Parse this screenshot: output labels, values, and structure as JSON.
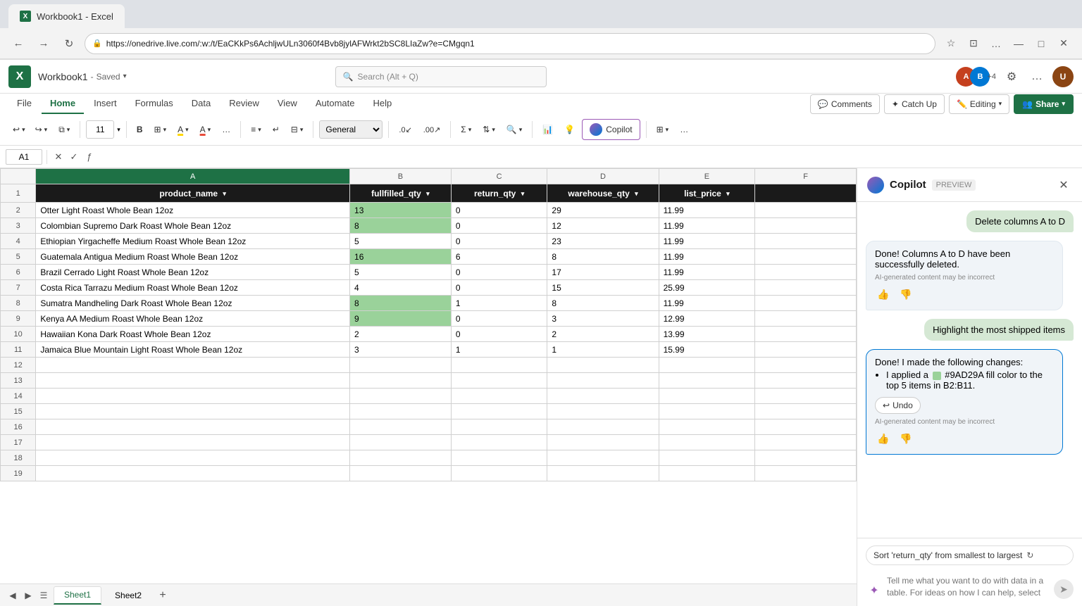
{
  "browser": {
    "tab_favicon": "X",
    "tab_title": "Workbook1 - Excel",
    "url": "https://onedrive.live.com/:w:/t/EaCKkPs6AchljwULn3060f4Bvb8jylAFWrkt2bSC8LIaZw?e=CMgqn1",
    "back_btn": "←",
    "forward_btn": "→",
    "refresh_btn": "↻",
    "star_icon": "☆",
    "collections_icon": "⊡",
    "more_icon": "…",
    "minimize_icon": "—",
    "maximize_icon": "□",
    "close_icon": "✕"
  },
  "app_header": {
    "logo": "X",
    "title": "Workbook1",
    "save_status": "Saved",
    "search_placeholder": "Search (Alt + Q)",
    "gear_icon": "⚙",
    "more_icon": "…",
    "avatar1_text": "A",
    "avatar2_text": "B",
    "plus_count": "+4",
    "user_avatar": "U"
  },
  "ribbon": {
    "tabs": [
      {
        "label": "File",
        "active": false
      },
      {
        "label": "Home",
        "active": true
      },
      {
        "label": "Insert",
        "active": false
      },
      {
        "label": "Formulas",
        "active": false
      },
      {
        "label": "Data",
        "active": false
      },
      {
        "label": "Review",
        "active": false
      },
      {
        "label": "View",
        "active": false
      },
      {
        "label": "Automate",
        "active": false
      },
      {
        "label": "Help",
        "active": false
      }
    ],
    "undo_icon": "↩",
    "redo_icon": "↪",
    "clipboard_icon": "⧉",
    "font_size": "11",
    "bold_icon": "B",
    "borders_icon": "⊞",
    "fill_icon": "A",
    "font_color_icon": "A",
    "more_icon": "…",
    "align_icon": "≡",
    "wrap_icon": "⬡",
    "merge_icon": "⊟",
    "format_label": "General",
    "decrease_decimal": ".0",
    "increase_decimal": ".00",
    "sum_icon": "Σ",
    "sort_icon": "⇅",
    "find_icon": "⌕",
    "analyze_icon": "📊",
    "ideas_icon": "💡",
    "copilot_label": "Copilot",
    "comments_label": "Comments",
    "catchup_label": "Catch Up",
    "editing_label": "Editing",
    "share_label": "Share",
    "grid_icon": "⊞"
  },
  "formula_bar": {
    "cell_ref": "A1",
    "cancel_icon": "✕",
    "confirm_icon": "✓",
    "function_icon": "ƒ",
    "formula_value": ""
  },
  "spreadsheet": {
    "columns": [
      "",
      "A",
      "B",
      "C",
      "D",
      "E",
      "F"
    ],
    "header_row": {
      "row_num": "1",
      "cells": [
        {
          "value": "product_name",
          "has_filter": true
        },
        {
          "value": "fullfilled_qty",
          "has_filter": true
        },
        {
          "value": "return_qty",
          "has_filter": true
        },
        {
          "value": "warehouse_qty",
          "has_filter": true
        },
        {
          "value": "list_price",
          "has_filter": true
        },
        {
          "value": "",
          "has_filter": false
        }
      ]
    },
    "rows": [
      {
        "row_num": "2",
        "cells": [
          "Otter Light Roast Whole Bean 12oz",
          "13",
          "0",
          "29",
          "11.99",
          ""
        ],
        "highlight_b": true
      },
      {
        "row_num": "3",
        "cells": [
          "Colombian Supremo Dark Roast Whole Bean 12oz",
          "8",
          "0",
          "12",
          "11.99",
          ""
        ],
        "highlight_b": true
      },
      {
        "row_num": "4",
        "cells": [
          "Ethiopian Yirgacheffe Medium Roast Whole Bean 12oz",
          "5",
          "0",
          "23",
          "11.99",
          ""
        ],
        "highlight_b": false
      },
      {
        "row_num": "5",
        "cells": [
          "Guatemala Antigua Medium Roast Whole Bean 12oz",
          "16",
          "6",
          "8",
          "11.99",
          ""
        ],
        "highlight_b": true
      },
      {
        "row_num": "6",
        "cells": [
          "Brazil Cerrado Light Roast Whole Bean 12oz",
          "5",
          "0",
          "17",
          "11.99",
          ""
        ],
        "highlight_b": false
      },
      {
        "row_num": "7",
        "cells": [
          "Costa Rica Tarrazu Medium Roast Whole Bean 12oz",
          "4",
          "0",
          "15",
          "25.99",
          ""
        ],
        "highlight_b": false
      },
      {
        "row_num": "8",
        "cells": [
          "Sumatra Mandheling Dark Roast Whole Bean 12oz",
          "8",
          "1",
          "8",
          "11.99",
          ""
        ],
        "highlight_b": true
      },
      {
        "row_num": "9",
        "cells": [
          "Kenya AA Medium Roast Whole Bean 12oz",
          "9",
          "0",
          "3",
          "12.99",
          ""
        ],
        "highlight_b": true
      },
      {
        "row_num": "10",
        "cells": [
          "Hawaiian Kona Dark Roast Whole Bean 12oz",
          "2",
          "0",
          "2",
          "13.99",
          ""
        ],
        "highlight_b": false
      },
      {
        "row_num": "11",
        "cells": [
          "Jamaica Blue Mountain Light Roast Whole Bean 12oz",
          "3",
          "1",
          "1",
          "15.99",
          ""
        ],
        "highlight_b": false
      },
      {
        "row_num": "12",
        "cells": [
          "",
          "",
          "",
          "",
          "",
          ""
        ],
        "highlight_b": false
      },
      {
        "row_num": "13",
        "cells": [
          "",
          "",
          "",
          "",
          "",
          ""
        ],
        "highlight_b": false
      },
      {
        "row_num": "14",
        "cells": [
          "",
          "",
          "",
          "",
          "",
          ""
        ],
        "highlight_b": false
      },
      {
        "row_num": "15",
        "cells": [
          "",
          "",
          "",
          "",
          "",
          ""
        ],
        "highlight_b": false
      },
      {
        "row_num": "16",
        "cells": [
          "",
          "",
          "",
          "",
          "",
          ""
        ],
        "highlight_b": false
      },
      {
        "row_num": "17",
        "cells": [
          "",
          "",
          "",
          "",
          "",
          ""
        ],
        "highlight_b": false
      },
      {
        "row_num": "18",
        "cells": [
          "",
          "",
          "",
          "",
          "",
          ""
        ],
        "highlight_b": false
      },
      {
        "row_num": "19",
        "cells": [
          "",
          "",
          "",
          "",
          "",
          ""
        ],
        "highlight_b": false
      }
    ],
    "highlight_color": "#9AD29A"
  },
  "sheet_tabs": [
    {
      "label": "Sheet1",
      "active": true
    },
    {
      "label": "Sheet2",
      "active": false
    }
  ],
  "copilot_panel": {
    "title": "Copilot",
    "preview_label": "PREVIEW",
    "close_icon": "✕",
    "messages": [
      {
        "type": "user",
        "text": "Delete columns A to D"
      },
      {
        "type": "ai",
        "text": "Done! Columns A to D have been successfully deleted.",
        "disclaimer": "AI-generated content may be incorrect",
        "active": false
      },
      {
        "type": "user",
        "text": "Highlight the most shipped items"
      },
      {
        "type": "ai",
        "intro": "Done! I made the following changes:",
        "bullets": [
          "I applied a #9AD29A fill color to the top 5 items in B2:B11."
        ],
        "undo_label": "Undo",
        "disclaimer": "AI-generated content may be incorrect",
        "active": true
      }
    ],
    "suggestion_chip": "Sort 'return_qty' from smallest to largest",
    "chat_placeholder": "Tell me what you want to do with data in a table. For ideas on how I can help, select the prompt guide.",
    "sparkle_icon": "✦",
    "send_icon": "➤"
  }
}
